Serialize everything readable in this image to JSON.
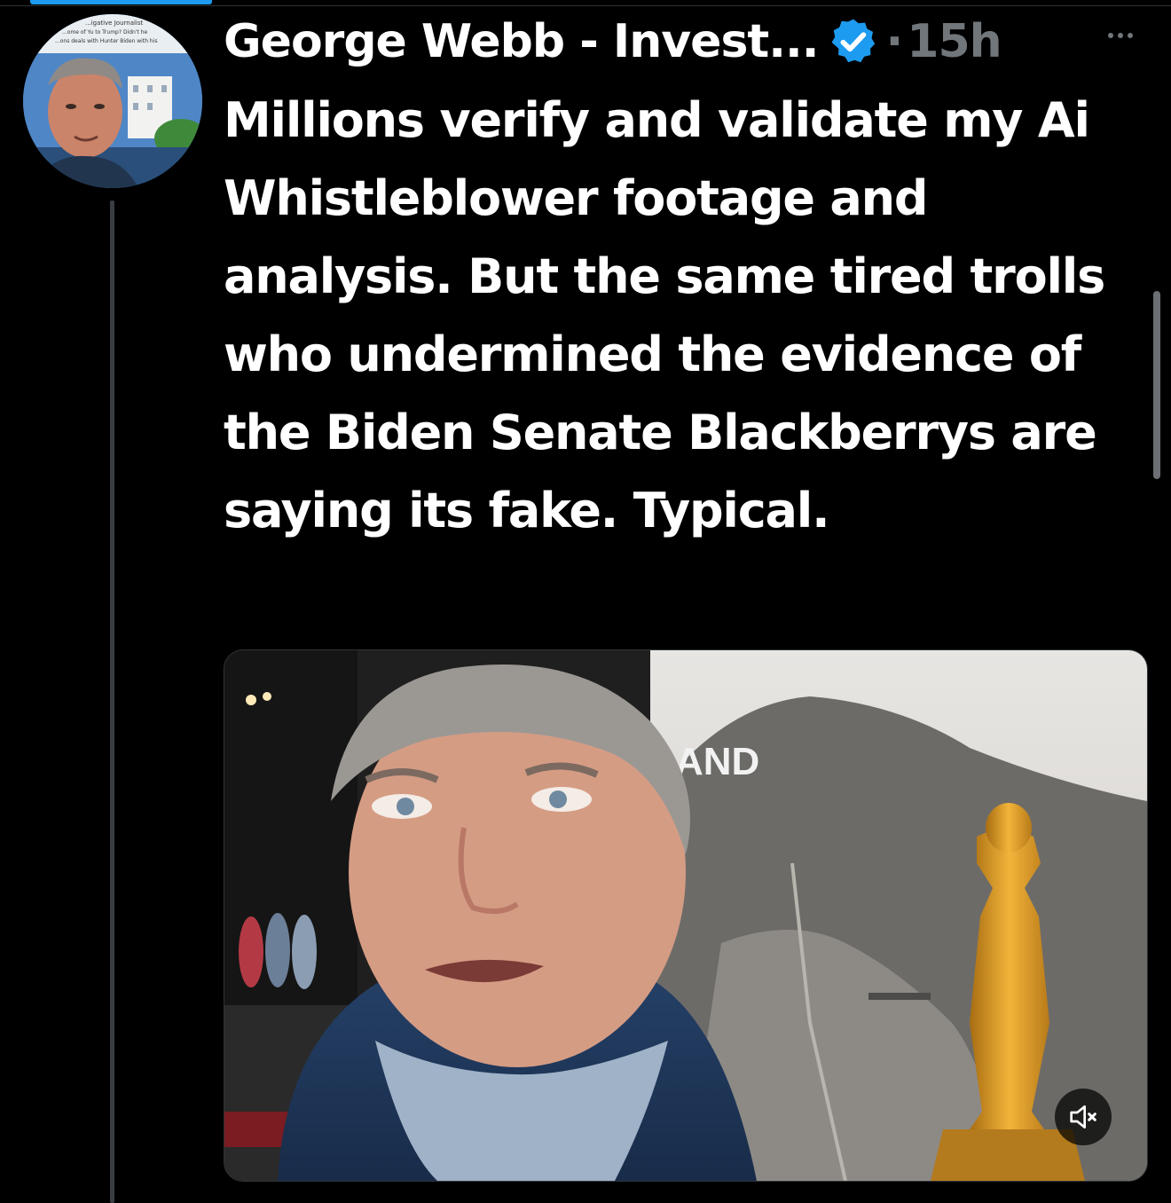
{
  "tweet": {
    "author_name": "George Webb - Invest...",
    "separator": "·",
    "timestamp": "15h",
    "text": "Millions verify and validate my Ai Whistleblower footage and analysis. But the same tired trolls who undermined the evidence of the Biden Senate Blackberrys are saying its fake. Typical."
  },
  "avatar": {
    "caption_lines": [
      "...igative Journalist",
      "...ome of Yu to Trump? Didn't he",
      "...ons deals with Hunter Biden with his"
    ]
  },
  "media": {
    "sign_text": "AND",
    "audio_state": "muted"
  },
  "icons": {
    "verified": "verified-badge-icon",
    "more": "more-options-icon",
    "mute": "speaker-muted-icon"
  },
  "colors": {
    "background": "#000000",
    "text": "#ffffff",
    "muted_text": "#71767b",
    "accent": "#1d9bf0"
  }
}
